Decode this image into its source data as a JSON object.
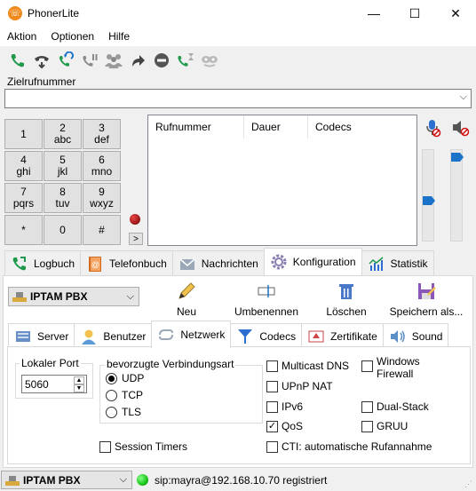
{
  "window": {
    "title": "PhonerLite",
    "minimize": "—",
    "maximize": "☐",
    "close": "✕"
  },
  "menu": [
    {
      "label": "Aktion"
    },
    {
      "label": "Optionen"
    },
    {
      "label": "Hilfe"
    }
  ],
  "toolbar_icons": [
    "call-icon",
    "hold-icon",
    "redial-icon",
    "pause-icon",
    "conference-icon",
    "forward-icon",
    "hangup-icon",
    "transfer-icon",
    "mask-icon"
  ],
  "ziel": {
    "label": "Zielrufnummer",
    "value": ""
  },
  "keypad": [
    {
      "digit": "1",
      "letters": ""
    },
    {
      "digit": "2",
      "letters": "abc"
    },
    {
      "digit": "3",
      "letters": "def"
    },
    {
      "digit": "4",
      "letters": "ghi"
    },
    {
      "digit": "5",
      "letters": "jkl"
    },
    {
      "digit": "6",
      "letters": "mno"
    },
    {
      "digit": "7",
      "letters": "pqrs"
    },
    {
      "digit": "8",
      "letters": "tuv"
    },
    {
      "digit": "9",
      "letters": "wxyz"
    },
    {
      "digit": "*",
      "letters": ""
    },
    {
      "digit": "0",
      "letters": ""
    },
    {
      "digit": "#",
      "letters": ""
    }
  ],
  "keypad_more": ">",
  "calllist": {
    "headers": [
      "Rufnummer",
      "Dauer",
      "Codecs"
    ]
  },
  "volume": {
    "mic_level": 0.45,
    "speaker_level": 0.98
  },
  "main_tabs": [
    {
      "label": "Logbuch",
      "icon": "logbook-icon"
    },
    {
      "label": "Telefonbuch",
      "icon": "phonebook-icon"
    },
    {
      "label": "Nachrichten",
      "icon": "messages-icon"
    },
    {
      "label": "Konfiguration",
      "icon": "gear-icon",
      "active": true
    },
    {
      "label": "Statistik",
      "icon": "chart-icon"
    }
  ],
  "config": {
    "profile": "IPTAM PBX",
    "buttons": [
      {
        "label": "Neu"
      },
      {
        "label": "Umbenennen"
      },
      {
        "label": "Löschen"
      },
      {
        "label": "Speichern als..."
      }
    ]
  },
  "sub_tabs": [
    {
      "label": "Server"
    },
    {
      "label": "Benutzer"
    },
    {
      "label": "Netzwerk",
      "active": true
    },
    {
      "label": "Codecs"
    },
    {
      "label": "Zertifikate"
    },
    {
      "label": "Sound"
    }
  ],
  "netzwerk": {
    "port_label": "Lokaler Port",
    "port_value": "5060",
    "conn_label": "bevorzugte Verbindungsart",
    "conn_options": [
      {
        "label": "UDP",
        "selected": true
      },
      {
        "label": "TCP"
      },
      {
        "label": "TLS"
      }
    ],
    "session_timers": "Session Timers",
    "checks": [
      {
        "label": "Multicast DNS",
        "checked": false
      },
      {
        "label": "UPnP NAT",
        "checked": false
      },
      {
        "label": "IPv6",
        "checked": false
      },
      {
        "label": "QoS",
        "checked": true
      },
      {
        "label": "CTI: automatische Rufannahme",
        "checked": false
      },
      {
        "label": "Windows Firewall",
        "checked": false
      },
      {
        "label": "Dual-Stack",
        "checked": false
      },
      {
        "label": "GRUU",
        "checked": false
      }
    ]
  },
  "status": {
    "profile": "IPTAM PBX",
    "text": "sip:mayra@192.168.10.70 registriert"
  },
  "colors": {
    "accent": "#1a73c8",
    "call_green": "#1e9a4a",
    "status_green": "#18c418",
    "record_red": "#b00000"
  }
}
